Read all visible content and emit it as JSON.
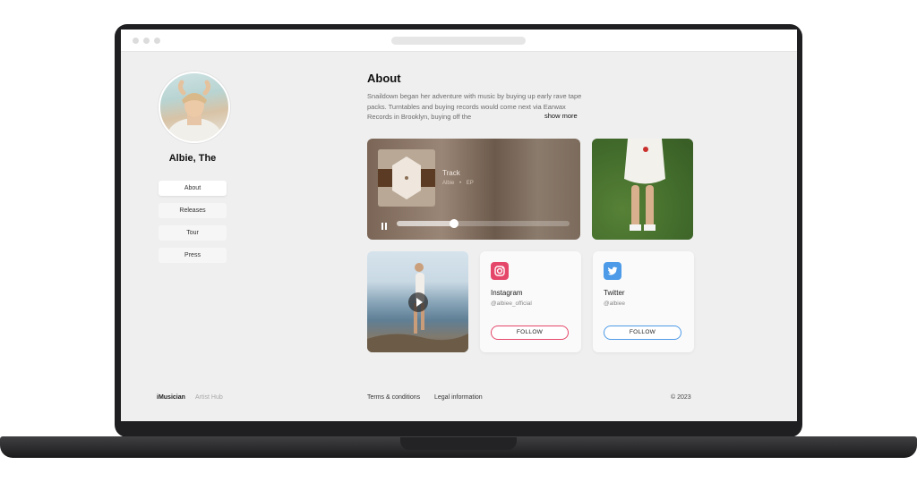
{
  "artist": {
    "name": "Albie, The"
  },
  "nav": {
    "items": [
      {
        "label": "About",
        "active": true
      },
      {
        "label": "Releases",
        "active": false
      },
      {
        "label": "Tour",
        "active": false
      },
      {
        "label": "Press",
        "active": false
      }
    ]
  },
  "about": {
    "title": "About",
    "text": "Snaildown began her adventure with music by buying up early rave tape packs. Turntables and buying records would come next via Earwax Records in Brooklyn, buying off the",
    "show_more": "show more"
  },
  "player": {
    "track_title": "Track",
    "artist": "Albie",
    "separator": "•",
    "type": "EP",
    "progress": 0.33,
    "state": "playing"
  },
  "socials": {
    "instagram": {
      "name": "Instagram",
      "handle": "@albiee_official",
      "follow_label": "FOLLOW",
      "color": "#e5476a"
    },
    "twitter": {
      "name": "Twitter",
      "handle": "@albiee",
      "follow_label": "FOLLOW",
      "color": "#4d9be8"
    }
  },
  "footer": {
    "brand": "iMusician",
    "sub": "Artist Hub",
    "links": [
      "Terms & conditions",
      "Legal information"
    ],
    "copyright": "© 2023"
  },
  "icons": {
    "pause": "pause-icon",
    "play": "play-icon",
    "instagram": "instagram-icon",
    "twitter": "twitter-icon"
  }
}
